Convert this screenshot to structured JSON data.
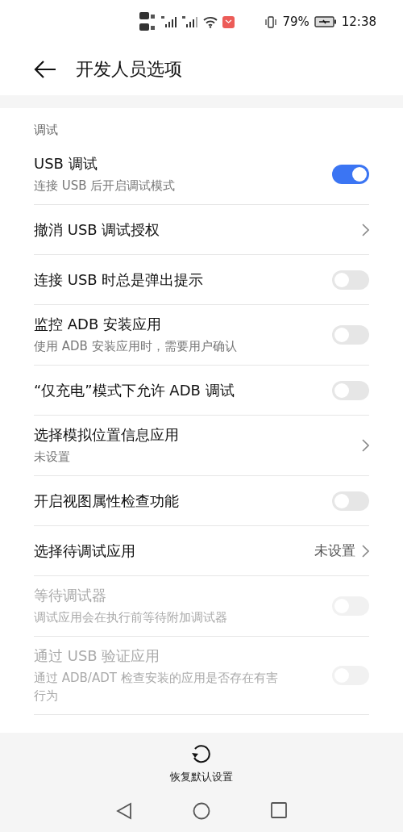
{
  "status_bar": {
    "battery": "79%",
    "time": "12:38"
  },
  "header": {
    "title": "开发人员选项"
  },
  "section": {
    "title": "调试"
  },
  "rows": [
    {
      "kind": "switch",
      "title": "USB 调试",
      "subtitle": "连接 USB 后开启调试模式",
      "on": true,
      "disabled": false
    },
    {
      "kind": "link",
      "title": "撤消 USB 调试授权",
      "disabled": false
    },
    {
      "kind": "switch",
      "title": "连接 USB 时总是弹出提示",
      "on": false,
      "disabled": false
    },
    {
      "kind": "switch",
      "title": "监控 ADB 安装应用",
      "subtitle": "使用 ADB 安装应用时，需要用户确认",
      "on": false,
      "disabled": false
    },
    {
      "kind": "switch",
      "title": "“仅充电”模式下允许 ADB 调试",
      "on": false,
      "disabled": false
    },
    {
      "kind": "link",
      "title": "选择模拟位置信息应用",
      "subtitle": "未设置",
      "disabled": false
    },
    {
      "kind": "switch",
      "title": "开启视图属性检查功能",
      "on": false,
      "disabled": false
    },
    {
      "kind": "link",
      "title": "选择待调试应用",
      "value": "未设置",
      "disabled": false
    },
    {
      "kind": "switch",
      "title": "等待调试器",
      "subtitle": "调试应用会在执行前等待附加调试器",
      "on": false,
      "disabled": true
    },
    {
      "kind": "switch",
      "title": "通过 USB 验证应用",
      "subtitle": "通过 ADB/ADT 检查安装的应用是否存在有害行为",
      "on": false,
      "disabled": true
    }
  ],
  "reset_button": {
    "label": "恢复默认设置"
  }
}
